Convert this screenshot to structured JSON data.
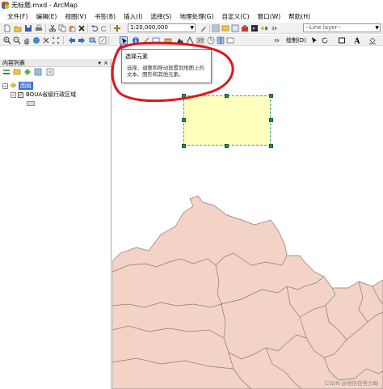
{
  "window": {
    "title": "无标题.mxd - ArcMap"
  },
  "menu": [
    "文件(F)",
    "编辑(E)",
    "视图(V)",
    "书签(B)",
    "插入(I)",
    "选择(S)",
    "地理处理(G)",
    "自定义(C)",
    "窗口(W)",
    "帮助(H)"
  ],
  "toolbar": {
    "scale_value": "1:20,000,000",
    "layer_dropdown": "--Line layer--",
    "drawing_label": "绘制(D)"
  },
  "toc": {
    "title": "内容列表",
    "pin": "▾ ",
    "close": "×",
    "data_frame": "图层",
    "layer_name": "BOUA省级行政区域"
  },
  "tooltip": {
    "title": "选择元素",
    "desc_line1": "选择、调整和移动放置到地图上的",
    "desc_line2": "文本、图形和其他元素。"
  },
  "watermark": "CSDN @地信在努力呦",
  "colors": {
    "map_fill": "#f2d3c6",
    "map_stroke": "#8a7a74",
    "selected_element_fill": "#ffffbe",
    "selection_handle": "#2e8b57",
    "annotation_circle": "#e0141e",
    "selected_layer_bg": "#3b6fd6"
  },
  "icons": {
    "new": "new-document-icon",
    "open": "open-folder-icon",
    "save": "save-icon",
    "print": "print-icon",
    "cut": "cut-icon",
    "copy": "copy-icon",
    "paste": "paste-icon",
    "delete": "delete-icon",
    "undo": "undo-icon",
    "redo": "redo-icon",
    "add_data": "add-data-icon",
    "select_elements": "select-elements-arrow-icon",
    "identify": "identify-icon",
    "zoom_in": "zoom-in-icon",
    "zoom_out": "zoom-out-icon",
    "pan": "pan-hand-icon",
    "full_extent": "full-extent-globe-icon"
  }
}
